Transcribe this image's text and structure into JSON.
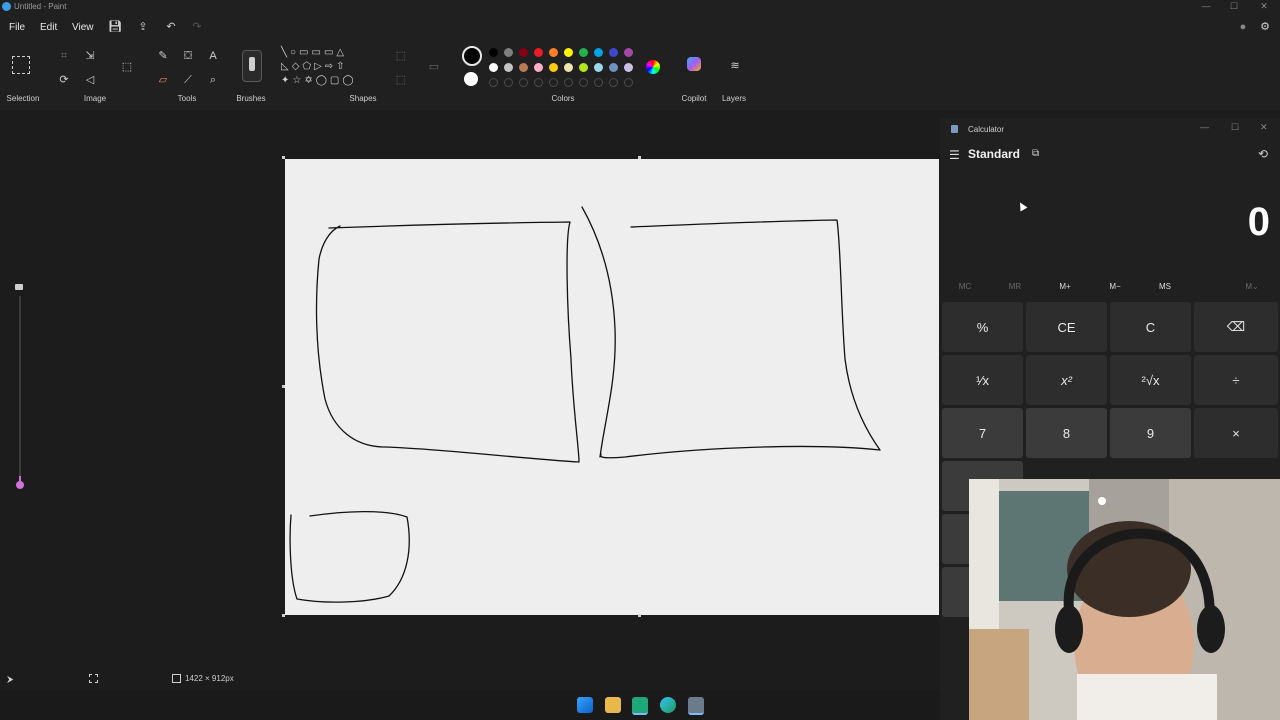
{
  "window": {
    "title": "Untitled - Paint"
  },
  "menu": {
    "file": "File",
    "edit": "Edit",
    "view": "View"
  },
  "ribbon": {
    "groups": {
      "selection": "Selection",
      "image": "Image",
      "tools": "Tools",
      "brushes": "Brushes",
      "shapes": "Shapes",
      "colors": "Colors",
      "copilot": "Copilot",
      "layers": "Layers"
    },
    "colors": {
      "primary": "#000000",
      "secondary": "#ffffff",
      "row1": [
        "#000000",
        "#7f7f7f",
        "#880015",
        "#ed1c24",
        "#ff7f27",
        "#fff200",
        "#22b14c",
        "#00a2e8",
        "#3f48cc",
        "#a349a4"
      ],
      "row2": [
        "#ffffff",
        "#c3c3c3",
        "#b97a57",
        "#ffaec9",
        "#ffc90e",
        "#efe4b0",
        "#b5e61d",
        "#99d9ea",
        "#7092be",
        "#c8bfe7"
      ]
    }
  },
  "status": {
    "canvas_size": "1422 × 912px"
  },
  "calculator": {
    "title": "Calculator",
    "mode": "Standard",
    "display": "0",
    "memory": [
      "MC",
      "MR",
      "M+",
      "M−",
      "MS",
      "M⌄"
    ],
    "keys": [
      [
        "%",
        "CE",
        "C",
        "⌫"
      ],
      [
        "¹⁄x",
        "x²",
        "²√x",
        "÷"
      ],
      [
        "7",
        "8",
        "9",
        "×"
      ]
    ]
  }
}
